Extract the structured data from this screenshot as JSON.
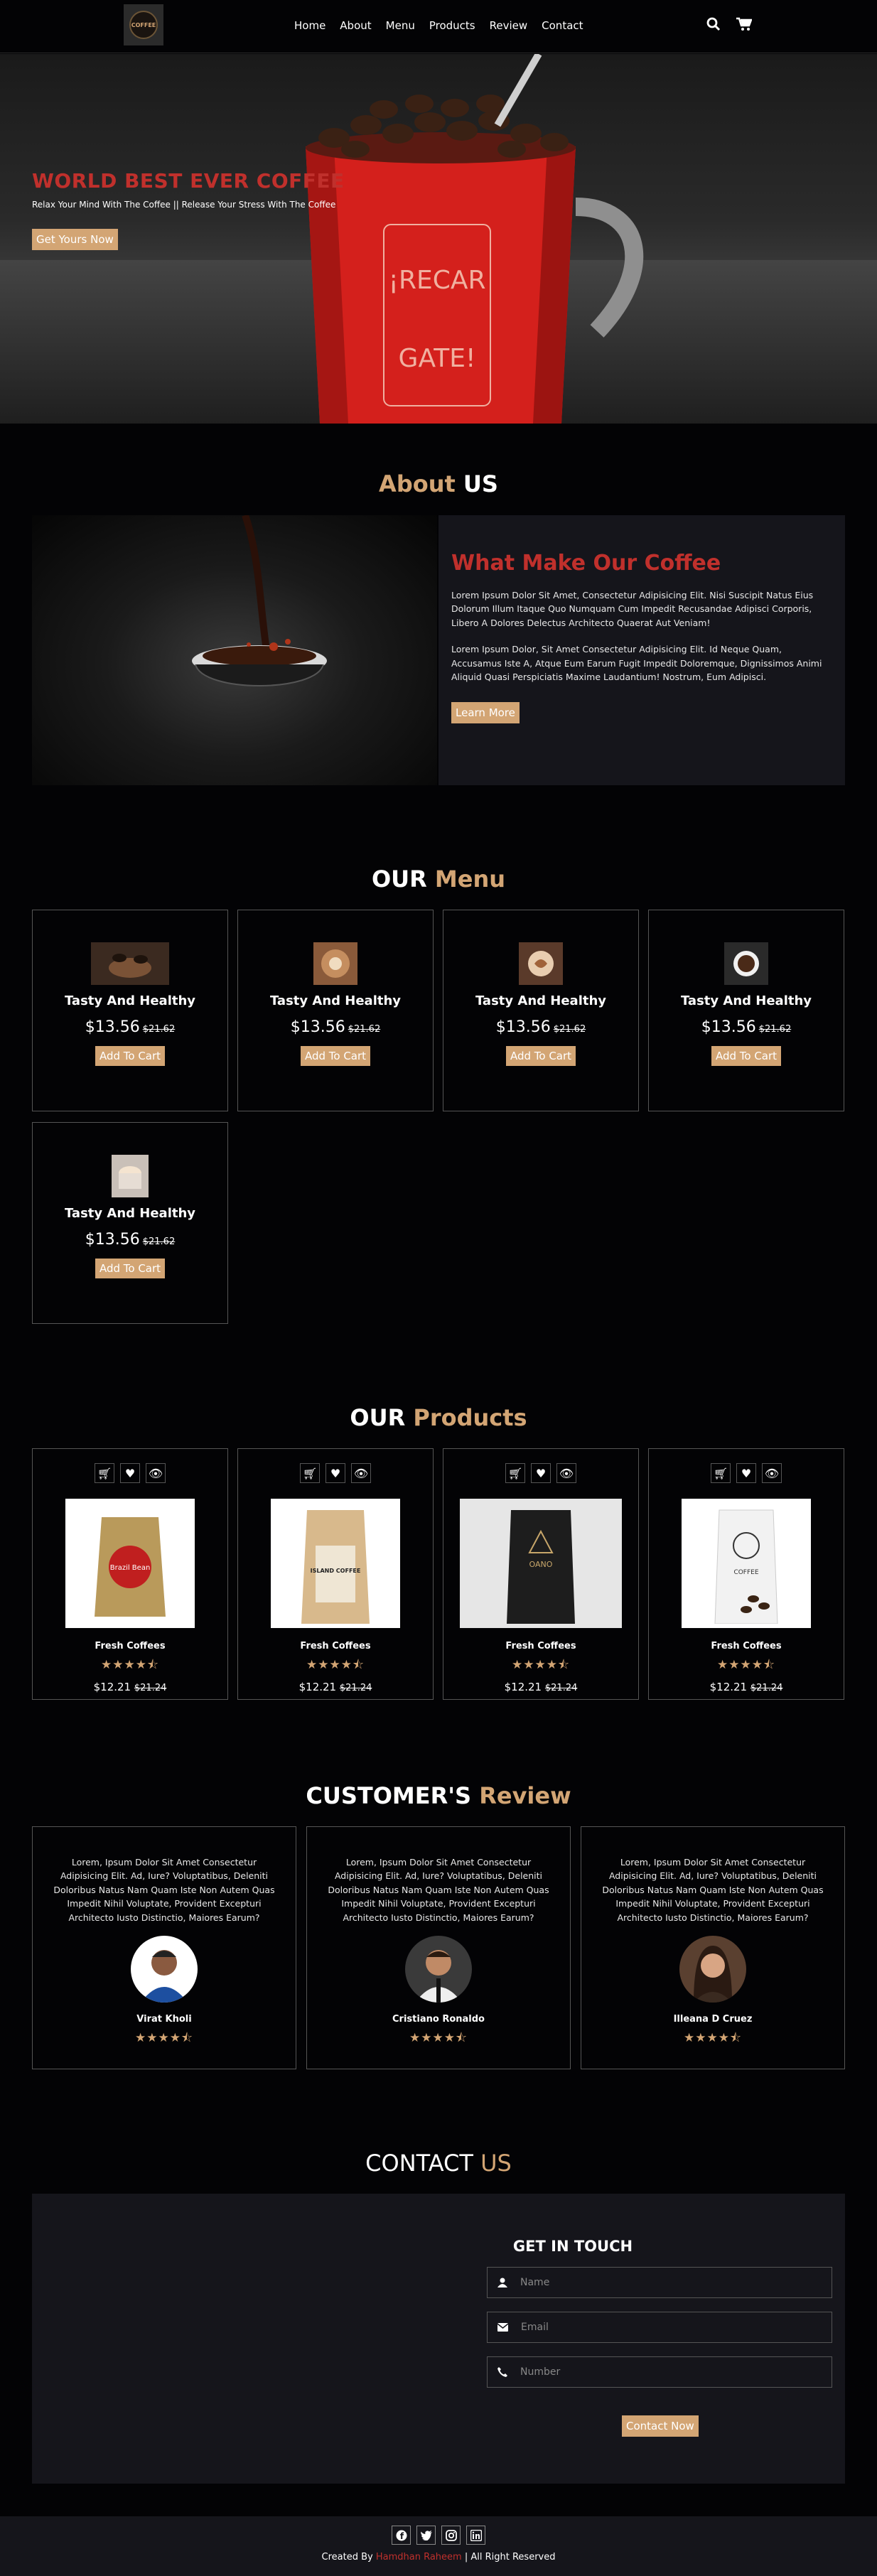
{
  "header": {
    "logo_text": "COFFEE",
    "nav": [
      "Home",
      "About",
      "Menu",
      "Products",
      "Review",
      "Contact"
    ],
    "icons": [
      "search-icon",
      "cart-icon"
    ]
  },
  "hero": {
    "title": "WORLD BEST EVER COFFEE",
    "subtitle": "Relax Your Mind With The Coffee || Release Your Stress With The Coffee",
    "button": "Get Yours Now",
    "mug_text": "¡RECAR GATE!"
  },
  "about": {
    "title_a": "About",
    "title_b": "US",
    "heading": "What Make Our Coffee",
    "para1": "Lorem Ipsum Dolor Sit Amet, Consectetur Adipisicing Elit. Nisi Suscipit Natus Eius Dolorum Illum Itaque Quo Numquam Cum Impedit Recusandae Adipisci Corporis, Libero A Dolores Delectus Architecto Quaerat Aut Veniam!",
    "para2": "Lorem Ipsum Dolor, Sit Amet Consectetur Adipisicing Elit. Id Neque Quam, Accusamus Iste A, Atque Eum Earum Fugit Impedit Doloremque, Dignissimos Animi Aliquid Quasi Perspiciatis Maxime Laudantium! Nostrum, Eum Adipisci.",
    "button": "Learn More"
  },
  "menu": {
    "title_a": "OUR",
    "title_b": "Menu",
    "items": [
      {
        "name": "Tasty And Healthy",
        "price": "$13.56",
        "old_price": "$21.62",
        "button": "Add To Cart"
      },
      {
        "name": "Tasty And Healthy",
        "price": "$13.56",
        "old_price": "$21.62",
        "button": "Add To Cart"
      },
      {
        "name": "Tasty And Healthy",
        "price": "$13.56",
        "old_price": "$21.62",
        "button": "Add To Cart"
      },
      {
        "name": "Tasty And Healthy",
        "price": "$13.56",
        "old_price": "$21.62",
        "button": "Add To Cart"
      },
      {
        "name": "Tasty And Healthy",
        "price": "$13.56",
        "old_price": "$21.62",
        "button": "Add To Cart"
      }
    ]
  },
  "products": {
    "title_a": "OUR",
    "title_b": "Products",
    "items": [
      {
        "name": "Fresh Coffees",
        "stars": "★★★★⯪",
        "price": "$12.21",
        "old_price": "$21.24",
        "package_label": "Brazil Bean"
      },
      {
        "name": "Fresh Coffees",
        "stars": "★★★★⯪",
        "price": "$12.21",
        "old_price": "$21.24",
        "package_label": "ISLAND COFFEE"
      },
      {
        "name": "Fresh Coffees",
        "stars": "★★★★⯪",
        "price": "$12.21",
        "old_price": "$21.24",
        "package_label": "OANO"
      },
      {
        "name": "Fresh Coffees",
        "stars": "★★★★⯪",
        "price": "$12.21",
        "old_price": "$21.24",
        "package_label": "COFFEE"
      }
    ]
  },
  "review": {
    "title_a": "CUSTOMER'S",
    "title_b": "Review",
    "items": [
      {
        "text": "Lorem, Ipsum Dolor Sit Amet Consectetur Adipisicing Elit. Ad, Iure? Voluptatibus, Deleniti Doloribus Natus Nam Quam Iste Non Autem Quas Impedit Nihil Voluptate, Provident Excepturi Architecto Iusto Distinctio, Maiores Earum?",
        "name": "Virat Kholi",
        "stars": "★★★★⯪"
      },
      {
        "text": "Lorem, Ipsum Dolor Sit Amet Consectetur Adipisicing Elit. Ad, Iure? Voluptatibus, Deleniti Doloribus Natus Nam Quam Iste Non Autem Quas Impedit Nihil Voluptate, Provident Excepturi Architecto Iusto Distinctio, Maiores Earum?",
        "name": "Cristiano Ronaldo",
        "stars": "★★★★⯪"
      },
      {
        "text": "Lorem, Ipsum Dolor Sit Amet Consectetur Adipisicing Elit. Ad, Iure? Voluptatibus, Deleniti Doloribus Natus Nam Quam Iste Non Autem Quas Impedit Nihil Voluptate, Provident Excepturi Architecto Iusto Distinctio, Maiores Earum?",
        "name": "Illeana D Cruez",
        "stars": "★★★★⯪"
      }
    ]
  },
  "contact": {
    "title_a": "CONTACT",
    "title_b": "US",
    "heading": "GET IN TOUCH",
    "name_placeholder": "Name",
    "email_placeholder": "Email",
    "number_placeholder": "Number",
    "button": "Contact Now"
  },
  "footer": {
    "social": [
      "facebook-icon",
      "twitter-icon",
      "instagram-icon",
      "linkedin-icon"
    ],
    "created_by": "Created By",
    "author": "Hamdhan Raheem",
    "rights": "| All Right Reserved"
  },
  "colors": {
    "accent": "#d3a574",
    "red": "#c0302c",
    "panel": "#15151b",
    "bg": "#030305"
  }
}
